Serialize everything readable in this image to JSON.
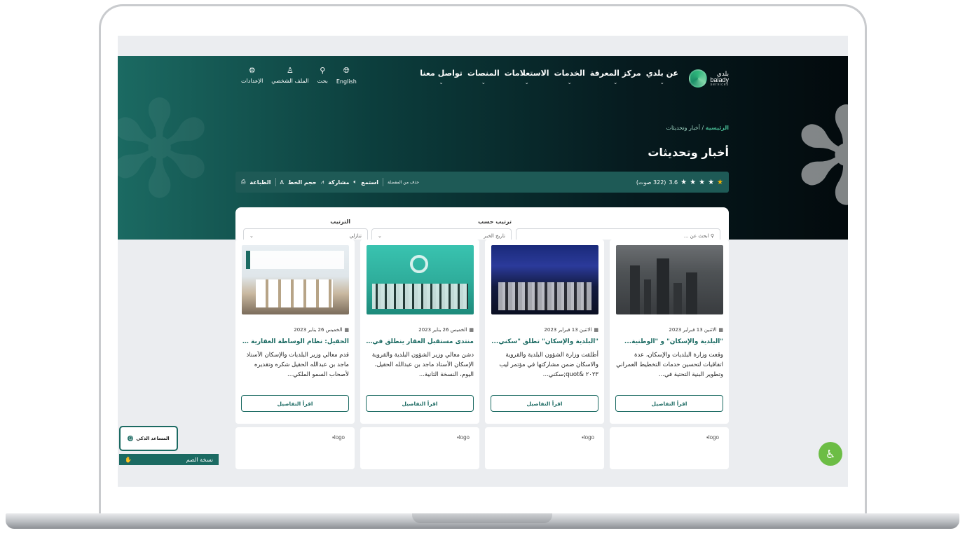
{
  "header": {
    "logo_name": "بلدي",
    "logo_latin": "balady",
    "logo_sub": "services",
    "nav": [
      "عن بلدي",
      "مركز المعرفة",
      "الخدمات",
      "الاستعلامات",
      "المنصات",
      "تواصل معنا"
    ],
    "tools": [
      {
        "label": "English",
        "icon": "globe-icon"
      },
      {
        "label": "بحث",
        "icon": "search-icon"
      },
      {
        "label": "الملف الشخصي",
        "icon": "user-icon"
      },
      {
        "label": "الإعدادات",
        "icon": "gear-icon"
      }
    ]
  },
  "breadcrumb": {
    "home": "الرئيسية",
    "sep": "/",
    "current": "أخبار وتحديثات"
  },
  "page_title": "أخبار وتحديثات",
  "rating": {
    "value": "3.6",
    "votes": "(322 صوت)",
    "stars": 5
  },
  "actions": {
    "remove_fav": "حذف من المفضلة",
    "listen": "استمع",
    "share": "مشاركة",
    "font_size": "حجم الخط",
    "print": "الطباعة"
  },
  "filter": {
    "search_placeholder": "ابحث عن ...",
    "sort_by_label": "ترتيب حسب",
    "sort_by_value": "تاريخ الخبر",
    "order_label": "الترتيب",
    "order_value": "تنازلي"
  },
  "cards": [
    {
      "date": "الاثنين 13 فبراير 2023",
      "title": "\"البلدية والإسكان\" و \"الوطنية...",
      "desc": "وقعت وزارة البلديات والإسكان، عدة اتفاقيات لتحسين خدمات التخطيط العمراني وتطوير البنية التحتية في...",
      "button": "اقرأ التفاصيل",
      "image": "city-skyline"
    },
    {
      "date": "الاثنين 13 فبراير 2023",
      "title": "\"البلدية والإسكان\" تطلق \"سكني...",
      "desc": "أطلقت وزارة الشؤون البلدية والقروية والاسكان ضمن مشاركتها في مؤتمر ليب ٢٠٢٣ &quot;سكني...",
      "button": "اقرأ التفاصيل",
      "image": "conference-hall"
    },
    {
      "date": "الخميس 26 يناير 2023",
      "title": "منتدى مستقبل العقار ينطلق في...",
      "desc": "دشن معالي وزير الشؤون البلدية والقروية الإسكان الأستاذ ماجد بن عبدالله الحقيل، اليوم، النسخة الثانية...",
      "button": "اقرأ التفاصيل",
      "image": "forum-stage"
    },
    {
      "date": "الخميس 26 يناير 2023",
      "title": "الحقيل: نظام الوساطة العقارية داع...",
      "desc": "قدم معالي وزير البلديات والإسكان الأستاذ ماجد بن عبدالله الحقيل شكره وتقديره لأصحاب السمو الملكي...",
      "button": "اقرأ التفاصيل",
      "image": "signing-ceremony"
    }
  ],
  "cards2_logo": [
    "logo",
    "logo",
    "logo",
    "logo"
  ],
  "assistant_label": "المساعد الذكي",
  "deaf_label": "نسخة الصم",
  "colors": {
    "primary": "#1b6a62",
    "accent": "#6cbd45",
    "star": "#f5b400"
  }
}
